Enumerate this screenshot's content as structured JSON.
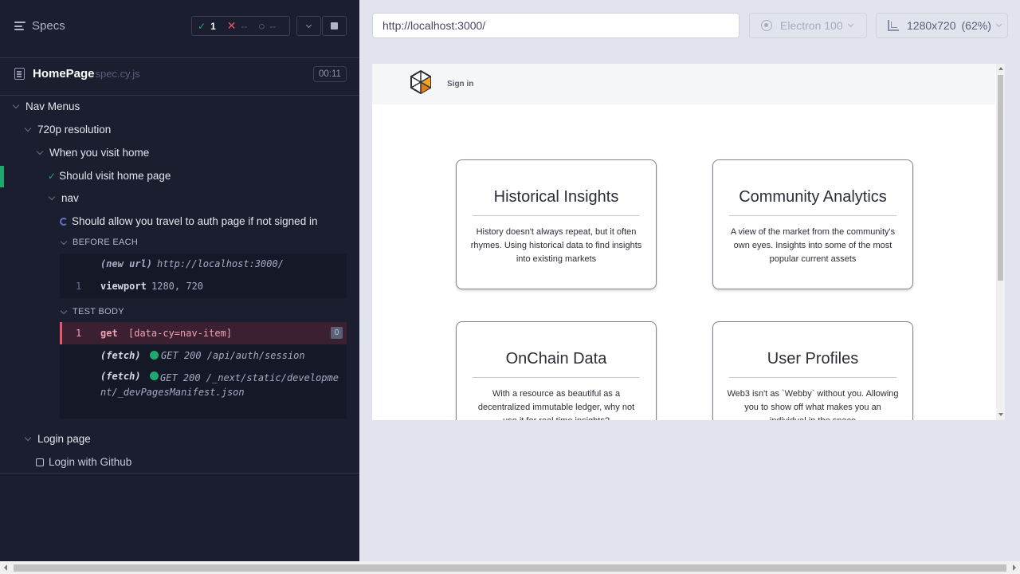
{
  "reporter": {
    "specs_label": "Specs",
    "stats": {
      "passed": "1",
      "failed": "--",
      "pending": "--"
    },
    "spec": {
      "name": "HomePage",
      "ext": "spec.cy.js",
      "duration": "00:11"
    },
    "tree": {
      "nav_menus": "Nav Menus",
      "res_720": "720p resolution",
      "visit_home": "When you visit home",
      "should_visit": "Should visit home page",
      "nav": "nav",
      "should_allow": "Should allow you travel to auth page if not signed in",
      "before_each": "BEFORE EACH",
      "test_body": "TEST BODY",
      "login_page": "Login page",
      "login_github": "Login with Github"
    },
    "commands": {
      "new_url_name": "(new url)",
      "new_url_msg": "http://localhost:3000/",
      "viewport_idx": "1",
      "viewport_name": "viewport",
      "viewport_msg": "1280, 720",
      "get_idx": "1",
      "get_name": "get",
      "get_msg": "[data-cy=nav-item]",
      "get_badge": "0",
      "fetch1_name": "(fetch)",
      "fetch1_msg": "GET 200 /api/auth/session",
      "fetch2_name": "(fetch)",
      "fetch2_msg": "GET 200 /_next/static/development/_devPagesManifest.json"
    }
  },
  "toolbar": {
    "url": "http://localhost:3000/",
    "browser": "Electron 100",
    "viewport": "1280x720",
    "scale": "(62%)"
  },
  "app": {
    "signin": "Sign in",
    "cards": [
      {
        "title": "Historical Insights",
        "text": "History doesn't always repeat, but it often rhymes. Using historical data to find insights into existing markets"
      },
      {
        "title": "Community Analytics",
        "text": "A view of the market from the community's own eyes. Insights into some of the most popular current assets"
      },
      {
        "title": "OnChain Data",
        "text": "With a resource as beautiful as a decentralized immutable ledger, why not use it for real time insights?"
      },
      {
        "title": "User Profiles",
        "text": "Web3 isn't as `Webby` without you. Allowing you to show off what makes you an individual in the space"
      }
    ]
  },
  "colors": {
    "pass": "#1fa971",
    "fail": "#e45770",
    "sidebar_bg": "#1b1e2e",
    "app_bg": "#e1e3ed"
  },
  "icons": [
    "menu-icon",
    "check-icon",
    "x-icon",
    "spinner-icon",
    "chevron-down-icon",
    "stop-icon",
    "file-icon",
    "electron-icon",
    "ruler-icon",
    "logo-icon"
  ]
}
